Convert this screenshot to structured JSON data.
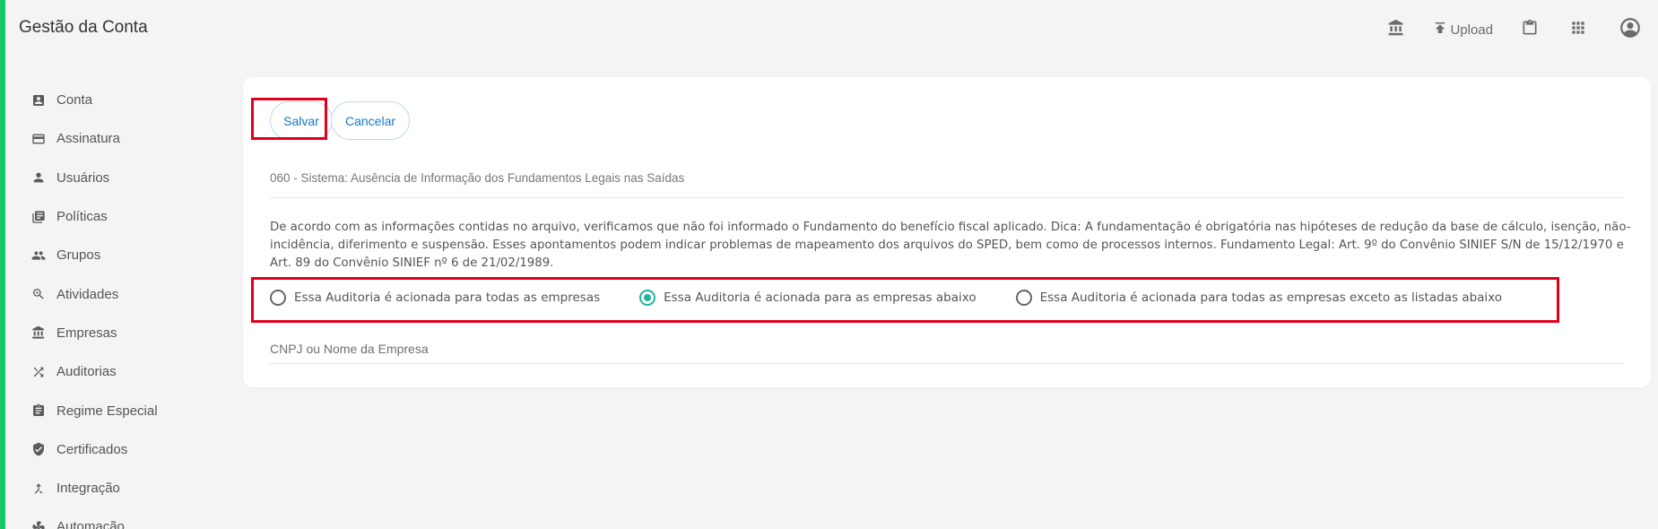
{
  "app": {
    "title": "Gestão da Conta",
    "accent_color": "#19c46b"
  },
  "topbar": {
    "upload_label": "Upload",
    "icons": [
      "bank-icon",
      "upload-icon",
      "clipboard-icon",
      "apps-grid-icon",
      "account-circle-icon"
    ]
  },
  "sidebar": {
    "items": [
      {
        "label": "Conta",
        "icon": "account-box-icon"
      },
      {
        "label": "Assinatura",
        "icon": "credit-card-icon"
      },
      {
        "label": "Usuários",
        "icon": "person-icon"
      },
      {
        "label": "Políticas",
        "icon": "library-books-icon"
      },
      {
        "label": "Grupos",
        "icon": "group-icon"
      },
      {
        "label": "Atividades",
        "icon": "zoom-search-icon"
      },
      {
        "label": "Empresas",
        "icon": "bank-icon"
      },
      {
        "label": "Auditorias",
        "icon": "shuffle-icon"
      },
      {
        "label": "Regime Especial",
        "icon": "assignment-icon"
      },
      {
        "label": "Certificados",
        "icon": "shield-check-icon"
      },
      {
        "label": "Integração",
        "icon": "merge-icon"
      },
      {
        "label": "Automação",
        "icon": "fan-icon"
      }
    ]
  },
  "form": {
    "save_label": "Salvar",
    "cancel_label": "Cancelar",
    "audit_title": "060 - Sistema: Ausência de Informação dos Fundamentos Legais nas Saídas",
    "audit_description": "De acordo com as informações contidas no arquivo, verificamos que não foi informado o Fundamento do benefício fiscal aplicado. Dica: A fundamentação é obrigatória nas hipóteses de redução da base de cálculo, isenção, não-incidência, diferimento e suspensão. Esses apontamentos podem indicar problemas de mapeamento dos arquivos do SPED, bem como de processos internos. Fundamento Legal: Art. 9º do Convênio SINIEF S/N de 15/12/1970 e Art. 89 do Convênio SINIEF nº 6 de 21/02/1989.",
    "radio_options": [
      {
        "label": "Essa Auditoria é acionada para todas as empresas",
        "selected": false
      },
      {
        "label": "Essa Auditoria é acionada para as empresas abaixo",
        "selected": true
      },
      {
        "label": "Essa Auditoria é acionada para todas as empresas exceto as listadas abaixo",
        "selected": false
      }
    ],
    "company_input": {
      "placeholder": "CNPJ ou Nome da Empresa",
      "value": ""
    },
    "highlight_color": "#e0001b",
    "radio_color": "#1fb3a0"
  }
}
